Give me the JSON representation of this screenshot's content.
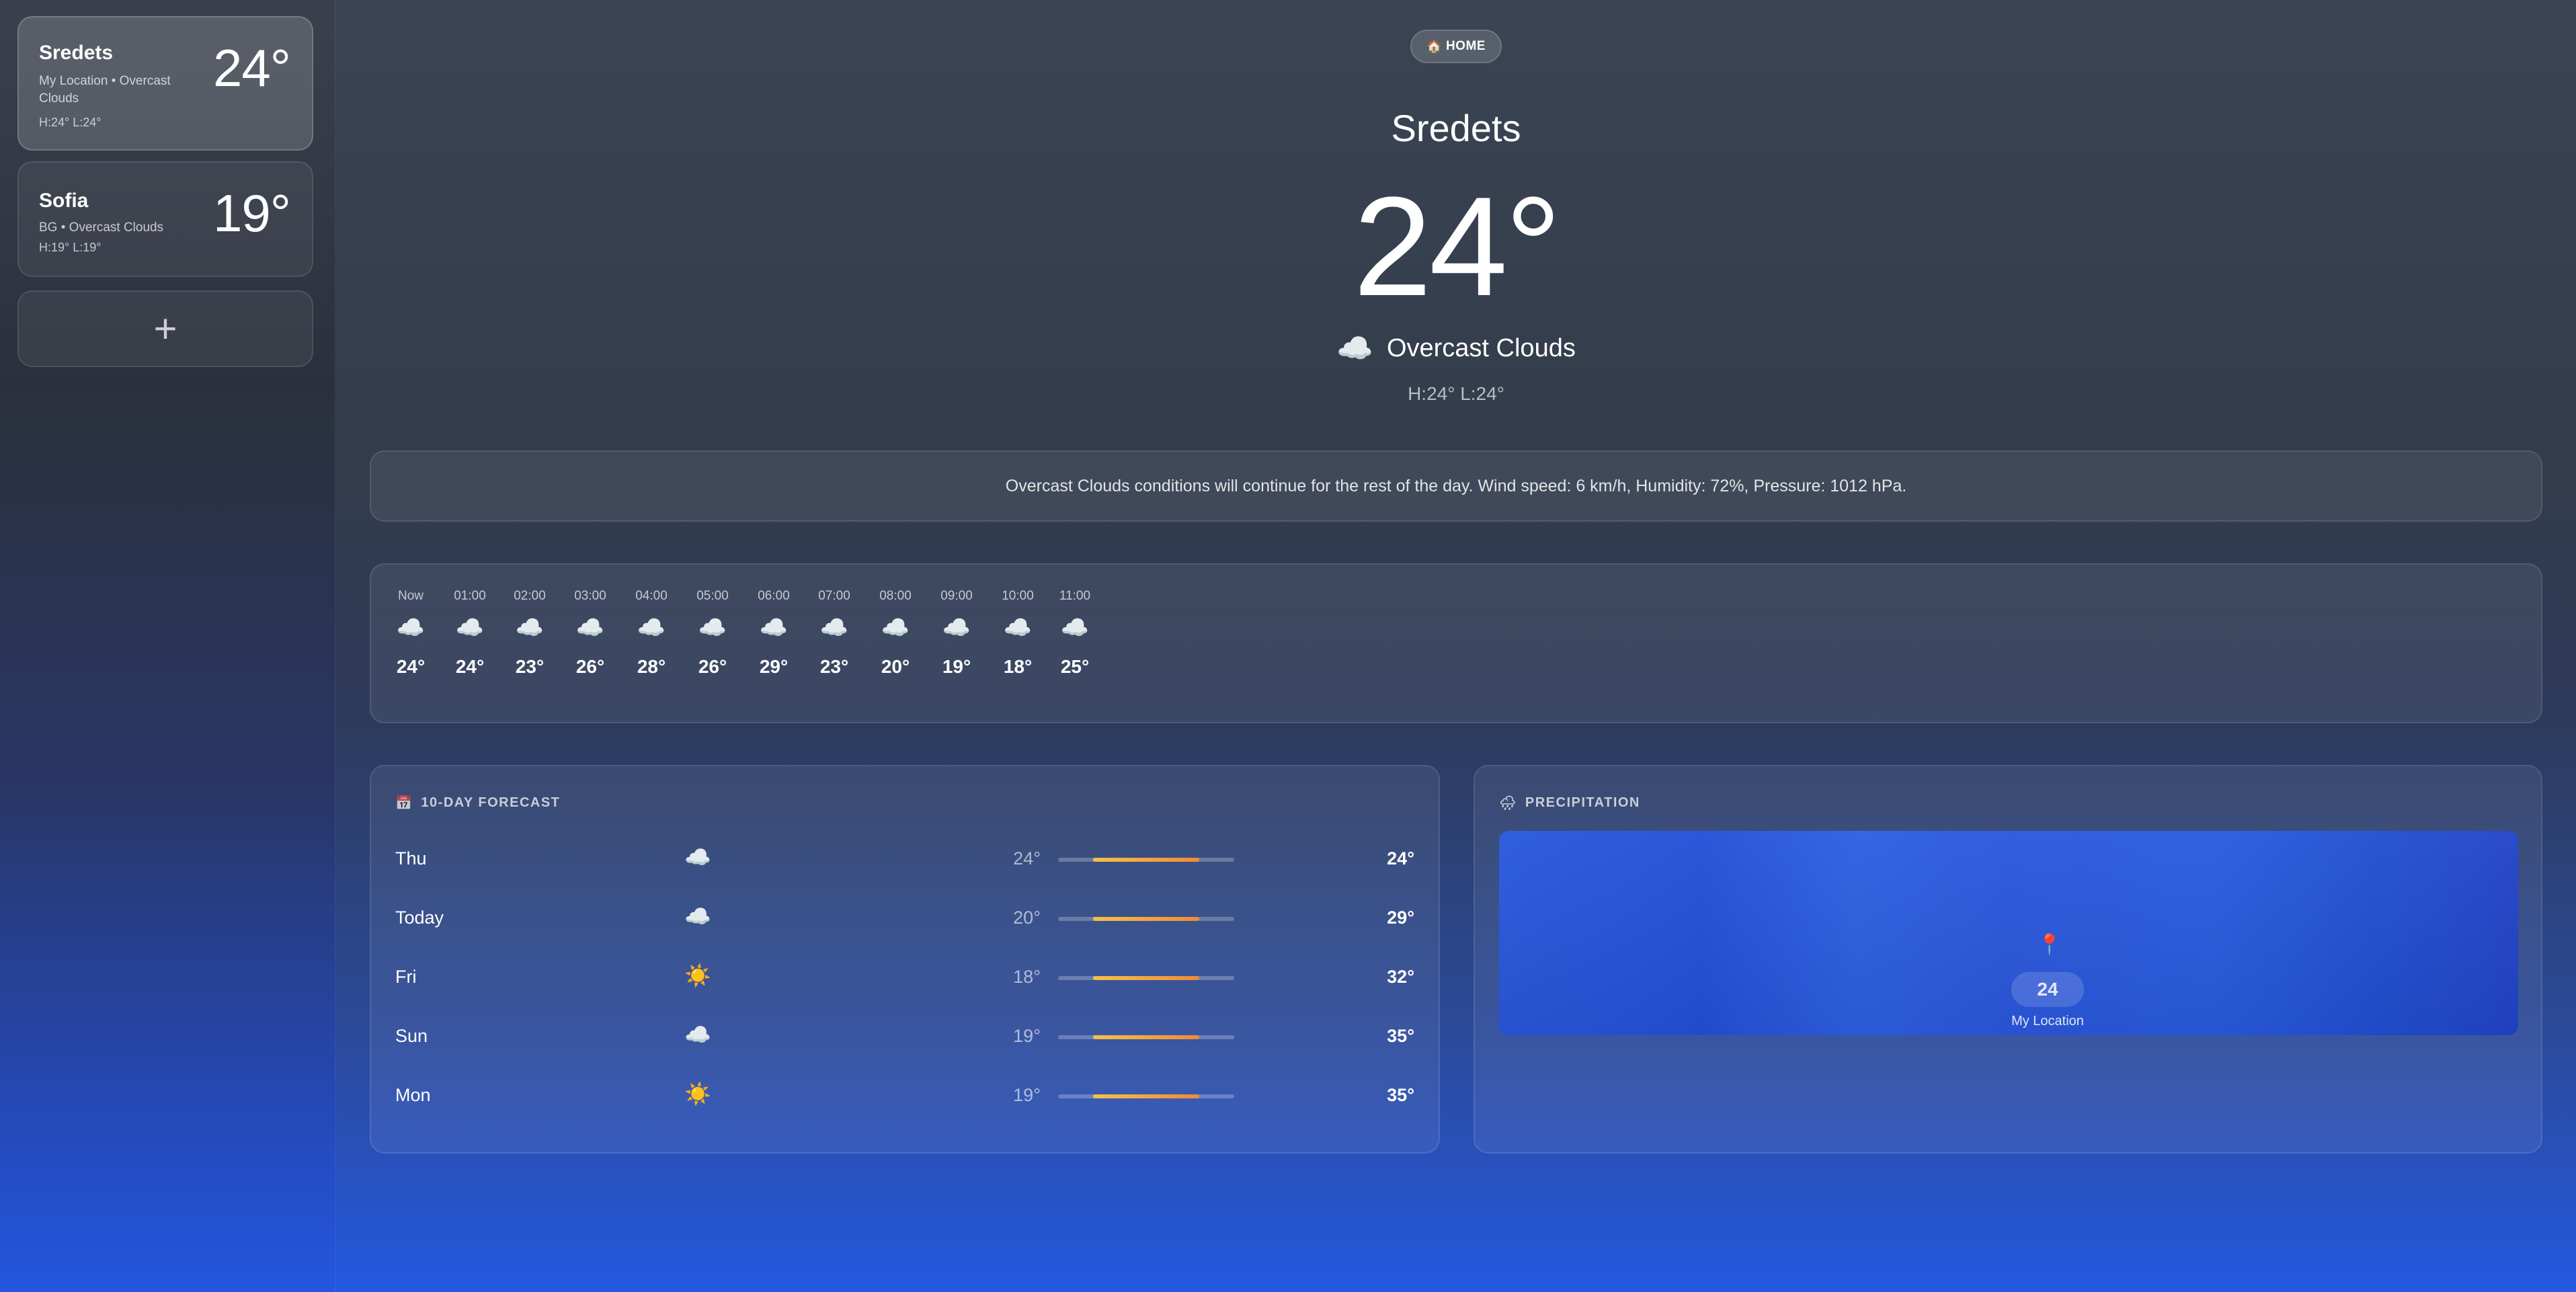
{
  "sidebar": {
    "locations": [
      {
        "name": "Sredets",
        "subtitle": "My Location • Overcast Clouds",
        "hl": "H:24° L:24°",
        "temp": "24°"
      },
      {
        "name": "Sofia",
        "subtitle": "BG • Overcast Clouds",
        "hl": "H:19° L:19°",
        "temp": "19°"
      }
    ],
    "add_label": "+"
  },
  "header": {
    "home_icon": "🏠",
    "home_label": "HOME",
    "city": "Sredets",
    "temp": "24°",
    "condition_icon": "☁️",
    "condition": "Overcast Clouds",
    "hl": "H:24° L:24°"
  },
  "summary": "Overcast Clouds conditions will continue for the rest of the day. Wind speed: 6 km/h, Humidity: 72%, Pressure: 1012 hPa.",
  "hourly": [
    {
      "time": "Now",
      "icon": "☁️",
      "temp": "24°"
    },
    {
      "time": "01:00",
      "icon": "☁️",
      "temp": "24°"
    },
    {
      "time": "02:00",
      "icon": "☁️",
      "temp": "23°"
    },
    {
      "time": "03:00",
      "icon": "☁️",
      "temp": "26°"
    },
    {
      "time": "04:00",
      "icon": "☁️",
      "temp": "28°"
    },
    {
      "time": "05:00",
      "icon": "☁️",
      "temp": "26°"
    },
    {
      "time": "06:00",
      "icon": "☁️",
      "temp": "29°"
    },
    {
      "time": "07:00",
      "icon": "☁️",
      "temp": "23°"
    },
    {
      "time": "08:00",
      "icon": "☁️",
      "temp": "20°"
    },
    {
      "time": "09:00",
      "icon": "☁️",
      "temp": "19°"
    },
    {
      "time": "10:00",
      "icon": "☁️",
      "temp": "18°"
    },
    {
      "time": "11:00",
      "icon": "☁️",
      "temp": "25°"
    }
  ],
  "forecast": {
    "icon": "📅",
    "title": "10-DAY FORECAST",
    "range_fill": {
      "start": 0.2,
      "end": 0.8
    },
    "days": [
      {
        "day": "Thu",
        "icon": "☁️",
        "low": "24°",
        "high": "24°"
      },
      {
        "day": "Today",
        "icon": "☁️",
        "low": "20°",
        "high": "29°"
      },
      {
        "day": "Fri",
        "icon": "☀️",
        "low": "18°",
        "high": "32°"
      },
      {
        "day": "Sun",
        "icon": "☁️",
        "low": "19°",
        "high": "35°"
      },
      {
        "day": "Mon",
        "icon": "☀️",
        "low": "19°",
        "high": "35°"
      }
    ]
  },
  "precipitation": {
    "icon": "🌧",
    "title": "PRECIPITATION",
    "pin_icon": "📍",
    "pin_value": "24",
    "pin_label": "My Location"
  }
}
